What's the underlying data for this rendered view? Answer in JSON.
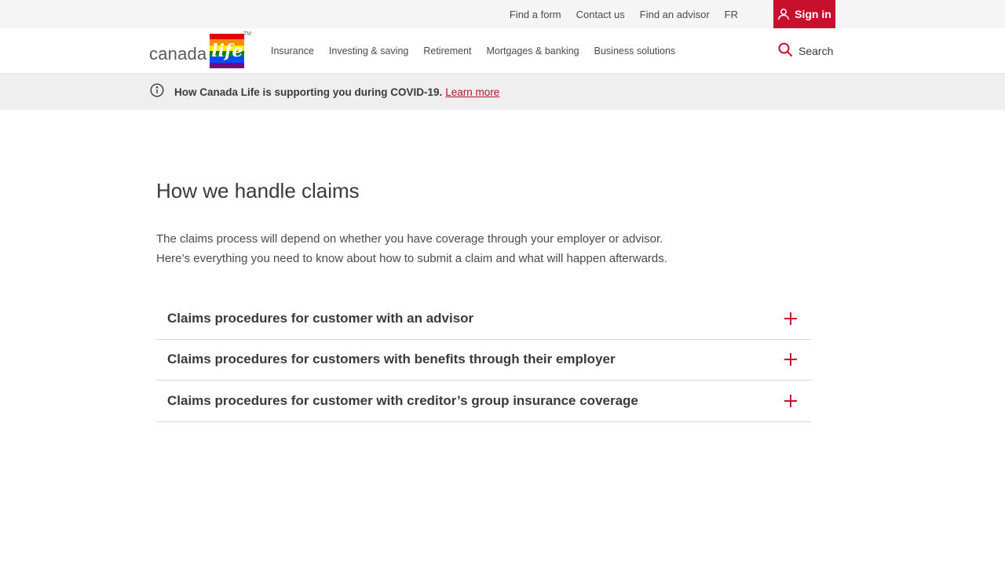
{
  "utility": {
    "links": [
      "Find a form",
      "Contact us",
      "Find an advisor",
      "FR"
    ],
    "sign_in": "Sign in"
  },
  "header": {
    "logo_text": "canada",
    "logo_mark": "life",
    "logo_tm": "TM",
    "nav": [
      "Insurance",
      "Investing & saving",
      "Retirement",
      "Mortgages & banking",
      "Business solutions"
    ],
    "search_label": "Search"
  },
  "alert": {
    "text": "How Canada Life is supporting you during COVID-19.",
    "link": "Learn more"
  },
  "main": {
    "title": "How we handle claims",
    "intro": "The claims process will depend on whether you have coverage through your employer or advisor. Here’s everything you need to know about how to submit a claim and what will happen afterwards.",
    "accordion": [
      "Claims procedures for customer with an advisor",
      "Claims procedures for customers with benefits through their employer",
      "Claims procedures for customer with creditor’s group insurance coverage"
    ]
  },
  "colors": {
    "accent": "#c8102e",
    "utility_bg": "#f5f5f5",
    "alert_bg": "#efefef",
    "text": "#3a3a3a"
  },
  "icons": {
    "user": "user-icon",
    "search": "search-icon",
    "info": "info-icon",
    "expand": "plus-icon"
  }
}
